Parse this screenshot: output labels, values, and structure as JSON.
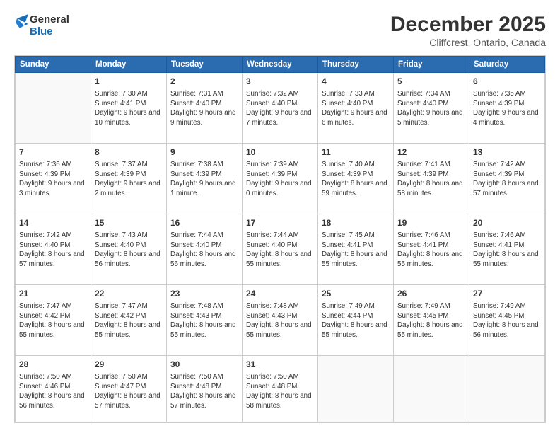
{
  "logo": {
    "line1": "General",
    "line2": "Blue"
  },
  "title": "December 2025",
  "subtitle": "Cliffcrest, Ontario, Canada",
  "days": [
    "Sunday",
    "Monday",
    "Tuesday",
    "Wednesday",
    "Thursday",
    "Friday",
    "Saturday"
  ],
  "weeks": [
    [
      {
        "num": "",
        "empty": true
      },
      {
        "num": "1",
        "sunrise": "7:30 AM",
        "sunset": "4:41 PM",
        "daylight": "9 hours and 10 minutes."
      },
      {
        "num": "2",
        "sunrise": "7:31 AM",
        "sunset": "4:40 PM",
        "daylight": "9 hours and 9 minutes."
      },
      {
        "num": "3",
        "sunrise": "7:32 AM",
        "sunset": "4:40 PM",
        "daylight": "9 hours and 7 minutes."
      },
      {
        "num": "4",
        "sunrise": "7:33 AM",
        "sunset": "4:40 PM",
        "daylight": "9 hours and 6 minutes."
      },
      {
        "num": "5",
        "sunrise": "7:34 AM",
        "sunset": "4:40 PM",
        "daylight": "9 hours and 5 minutes."
      },
      {
        "num": "6",
        "sunrise": "7:35 AM",
        "sunset": "4:39 PM",
        "daylight": "9 hours and 4 minutes."
      }
    ],
    [
      {
        "num": "7",
        "sunrise": "7:36 AM",
        "sunset": "4:39 PM",
        "daylight": "9 hours and 3 minutes."
      },
      {
        "num": "8",
        "sunrise": "7:37 AM",
        "sunset": "4:39 PM",
        "daylight": "9 hours and 2 minutes."
      },
      {
        "num": "9",
        "sunrise": "7:38 AM",
        "sunset": "4:39 PM",
        "daylight": "9 hours and 1 minute."
      },
      {
        "num": "10",
        "sunrise": "7:39 AM",
        "sunset": "4:39 PM",
        "daylight": "9 hours and 0 minutes."
      },
      {
        "num": "11",
        "sunrise": "7:40 AM",
        "sunset": "4:39 PM",
        "daylight": "8 hours and 59 minutes."
      },
      {
        "num": "12",
        "sunrise": "7:41 AM",
        "sunset": "4:39 PM",
        "daylight": "8 hours and 58 minutes."
      },
      {
        "num": "13",
        "sunrise": "7:42 AM",
        "sunset": "4:39 PM",
        "daylight": "8 hours and 57 minutes."
      }
    ],
    [
      {
        "num": "14",
        "sunrise": "7:42 AM",
        "sunset": "4:40 PM",
        "daylight": "8 hours and 57 minutes."
      },
      {
        "num": "15",
        "sunrise": "7:43 AM",
        "sunset": "4:40 PM",
        "daylight": "8 hours and 56 minutes."
      },
      {
        "num": "16",
        "sunrise": "7:44 AM",
        "sunset": "4:40 PM",
        "daylight": "8 hours and 56 minutes."
      },
      {
        "num": "17",
        "sunrise": "7:44 AM",
        "sunset": "4:40 PM",
        "daylight": "8 hours and 55 minutes."
      },
      {
        "num": "18",
        "sunrise": "7:45 AM",
        "sunset": "4:41 PM",
        "daylight": "8 hours and 55 minutes."
      },
      {
        "num": "19",
        "sunrise": "7:46 AM",
        "sunset": "4:41 PM",
        "daylight": "8 hours and 55 minutes."
      },
      {
        "num": "20",
        "sunrise": "7:46 AM",
        "sunset": "4:41 PM",
        "daylight": "8 hours and 55 minutes."
      }
    ],
    [
      {
        "num": "21",
        "sunrise": "7:47 AM",
        "sunset": "4:42 PM",
        "daylight": "8 hours and 55 minutes."
      },
      {
        "num": "22",
        "sunrise": "7:47 AM",
        "sunset": "4:42 PM",
        "daylight": "8 hours and 55 minutes."
      },
      {
        "num": "23",
        "sunrise": "7:48 AM",
        "sunset": "4:43 PM",
        "daylight": "8 hours and 55 minutes."
      },
      {
        "num": "24",
        "sunrise": "7:48 AM",
        "sunset": "4:43 PM",
        "daylight": "8 hours and 55 minutes."
      },
      {
        "num": "25",
        "sunrise": "7:49 AM",
        "sunset": "4:44 PM",
        "daylight": "8 hours and 55 minutes."
      },
      {
        "num": "26",
        "sunrise": "7:49 AM",
        "sunset": "4:45 PM",
        "daylight": "8 hours and 55 minutes."
      },
      {
        "num": "27",
        "sunrise": "7:49 AM",
        "sunset": "4:45 PM",
        "daylight": "8 hours and 56 minutes."
      }
    ],
    [
      {
        "num": "28",
        "sunrise": "7:50 AM",
        "sunset": "4:46 PM",
        "daylight": "8 hours and 56 minutes."
      },
      {
        "num": "29",
        "sunrise": "7:50 AM",
        "sunset": "4:47 PM",
        "daylight": "8 hours and 57 minutes."
      },
      {
        "num": "30",
        "sunrise": "7:50 AM",
        "sunset": "4:48 PM",
        "daylight": "8 hours and 57 minutes."
      },
      {
        "num": "31",
        "sunrise": "7:50 AM",
        "sunset": "4:48 PM",
        "daylight": "8 hours and 58 minutes."
      },
      {
        "num": "",
        "empty": true
      },
      {
        "num": "",
        "empty": true
      },
      {
        "num": "",
        "empty": true
      }
    ]
  ]
}
